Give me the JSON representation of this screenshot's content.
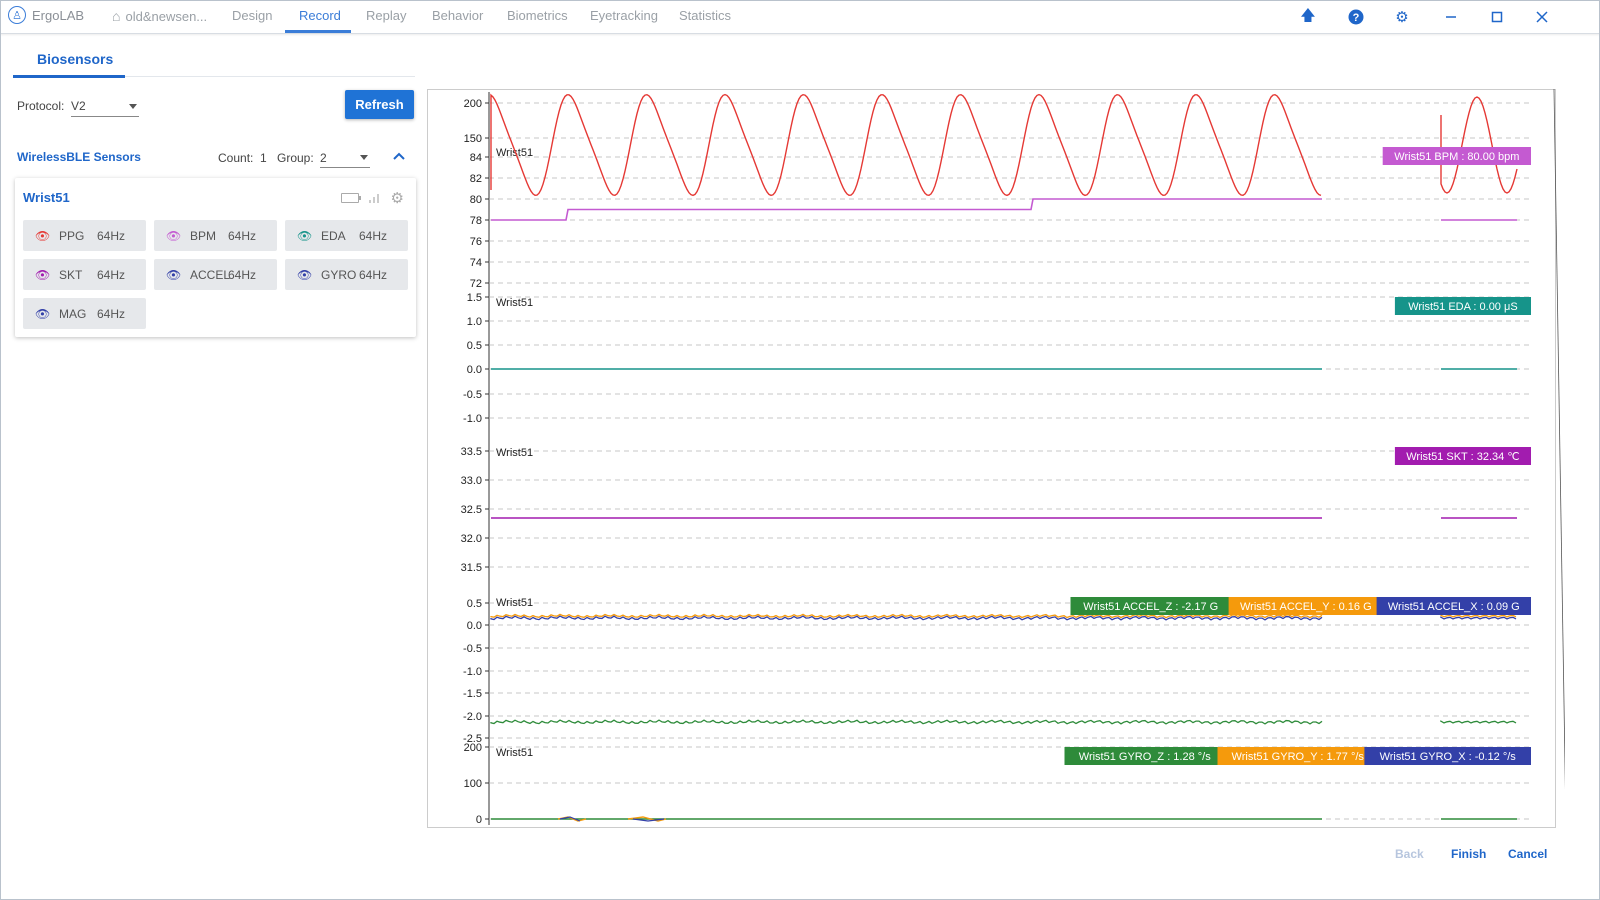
{
  "app": {
    "name": "ErgoLAB",
    "project": "old&newsen..."
  },
  "tabs": [
    "Design",
    "Record",
    "Replay",
    "Behavior",
    "Biometrics",
    "Eyetracking",
    "Statistics"
  ],
  "active_tab": "Record",
  "left": {
    "panel_title": "Biosensors",
    "protocol_label": "Protocol:",
    "protocol_value": "V2",
    "refresh_label": "Refresh",
    "section_title": "WirelessBLE Sensors",
    "count_label": "Count:",
    "count_value": "1",
    "group_label": "Group:",
    "group_value": "2",
    "device": {
      "name": "Wrist51",
      "sensors": [
        {
          "name": "PPG",
          "rate": "64Hz",
          "color": "#e53935"
        },
        {
          "name": "BPM",
          "rate": "64Hz",
          "color": "#c45ad1"
        },
        {
          "name": "EDA",
          "rate": "64Hz",
          "color": "#16948a"
        },
        {
          "name": "SKT",
          "rate": "64Hz",
          "color": "#a21caf"
        },
        {
          "name": "ACCEL",
          "rate": "64Hz",
          "color": "#3340a8"
        },
        {
          "name": "GYRO",
          "rate": "64Hz",
          "color": "#3340a8"
        },
        {
          "name": "MAG",
          "rate": "64Hz",
          "color": "#3340a8"
        }
      ]
    }
  },
  "footer": {
    "back": "Back",
    "finish": "Finish",
    "cancel": "Cancel"
  },
  "chart_data": [
    {
      "type": "line",
      "panel": "PPG / BPM",
      "device_label": "Wrist51",
      "yticks_upper": [
        "200",
        "150"
      ],
      "yticks_lower": [
        "84",
        "82",
        "80",
        "78",
        "76",
        "74",
        "72"
      ],
      "series": [
        {
          "name": "PPG",
          "color": "#e53935",
          "description": "periodic waveform, ~10 cycles over the window"
        },
        {
          "name": "BPM",
          "color": "#c45ad1",
          "values": [
            78,
            79,
            80,
            78
          ]
        }
      ],
      "readout": "Wrist51 BPM : 80.00 bpm",
      "readout_color": "#c45ad1"
    },
    {
      "type": "line",
      "panel": "EDA",
      "device_label": "Wrist51",
      "yticks": [
        "1.5",
        "1.0",
        "0.5",
        "0.0",
        "-0.5",
        "-1.0"
      ],
      "series": [
        {
          "name": "EDA",
          "color": "#16948a",
          "values": [
            0.0,
            0.0
          ]
        }
      ],
      "readout": "Wrist51 EDA : 0.00 μS",
      "readout_color": "#16948a"
    },
    {
      "type": "line",
      "panel": "SKT",
      "device_label": "Wrist51",
      "yticks": [
        "33.5",
        "33.0",
        "32.5",
        "32.0",
        "31.5"
      ],
      "series": [
        {
          "name": "SKT",
          "color": "#a21caf",
          "values": [
            32.34,
            32.34
          ]
        }
      ],
      "readout": "Wrist51 SKT : 32.34 ℃",
      "readout_color": "#a21caf"
    },
    {
      "type": "line",
      "panel": "ACCEL",
      "device_label": "Wrist51",
      "yticks": [
        "0.5",
        "0.0",
        "-0.5",
        "-1.0",
        "-1.5",
        "-2.0",
        "-2.5"
      ],
      "series": [
        {
          "name": "ACCEL_Z",
          "color": "#2e8b3a",
          "values": [
            -2.17,
            -2.17
          ]
        },
        {
          "name": "ACCEL_Y",
          "color": "#f59a0c",
          "values": [
            0.16,
            0.16
          ]
        },
        {
          "name": "ACCEL_X",
          "color": "#3340a8",
          "values": [
            0.09,
            0.09
          ]
        }
      ],
      "readouts": [
        {
          "text": "Wrist51 ACCEL_Z : -2.17 G",
          "color": "#2e8b3a"
        },
        {
          "text": "Wrist51 ACCEL_Y : 0.16 G",
          "color": "#f59a0c"
        },
        {
          "text": "Wrist51 ACCEL_X : 0.09 G",
          "color": "#3340a8"
        }
      ]
    },
    {
      "type": "line",
      "panel": "GYRO",
      "device_label": "Wrist51",
      "yticks": [
        "200",
        "100",
        "0"
      ],
      "series": [
        {
          "name": "GYRO_Z",
          "color": "#2e8b3a",
          "values": [
            1.28,
            1.28
          ]
        },
        {
          "name": "GYRO_Y",
          "color": "#f59a0c",
          "values": [
            1.77,
            1.77
          ]
        },
        {
          "name": "GYRO_X",
          "color": "#3340a8",
          "values": [
            -0.12,
            -0.12
          ]
        }
      ],
      "readouts": [
        {
          "text": "Wrist51 GYRO_Z : 1.28 °/s",
          "color": "#2e8b3a"
        },
        {
          "text": "Wrist51 GYRO_Y : 1.77 °/s",
          "color": "#f59a0c"
        },
        {
          "text": "Wrist51 GYRO_X : -0.12 °/s",
          "color": "#3340a8"
        }
      ]
    }
  ]
}
